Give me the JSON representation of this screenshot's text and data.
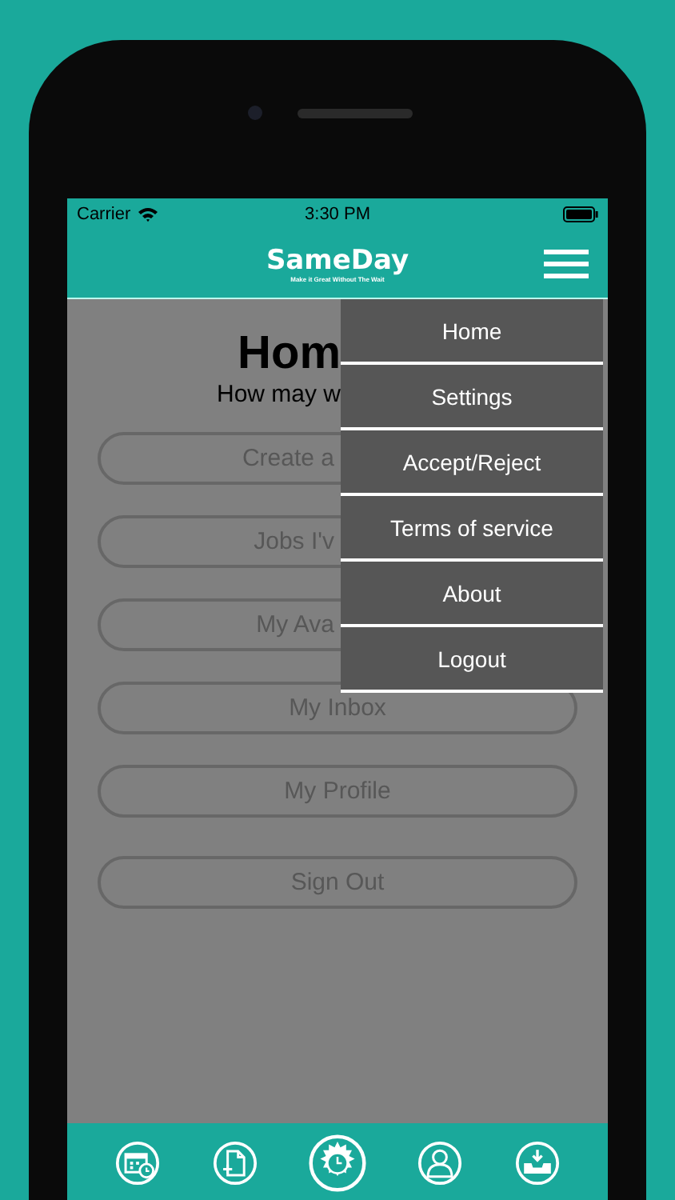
{
  "status_bar": {
    "carrier": "Carrier",
    "time": "3:30 PM"
  },
  "header": {
    "logo": "SameDay",
    "tagline": "Make it Great Without The Wait"
  },
  "home": {
    "title": "Hom",
    "subtitle": "How may w",
    "buttons": [
      {
        "label": "Create a",
        "kind": "partial"
      },
      {
        "label": "Jobs I'v",
        "kind": "partial"
      },
      {
        "label": "My Ava",
        "kind": "partial"
      },
      {
        "label": "My Inbox",
        "kind": "full"
      },
      {
        "label": "My Profile",
        "kind": "full"
      },
      {
        "label": "Sign Out",
        "kind": "full"
      }
    ]
  },
  "menu": {
    "items": [
      "Home",
      "Settings",
      "Accept/Reject",
      "Terms of service",
      "About",
      "Logout"
    ]
  },
  "tab_bar": [
    {
      "kind": "calendar",
      "selected": false
    },
    {
      "kind": "document",
      "selected": false
    },
    {
      "kind": "clock",
      "selected": true
    },
    {
      "kind": "person",
      "selected": false
    },
    {
      "kind": "inbox",
      "selected": false
    }
  ]
}
